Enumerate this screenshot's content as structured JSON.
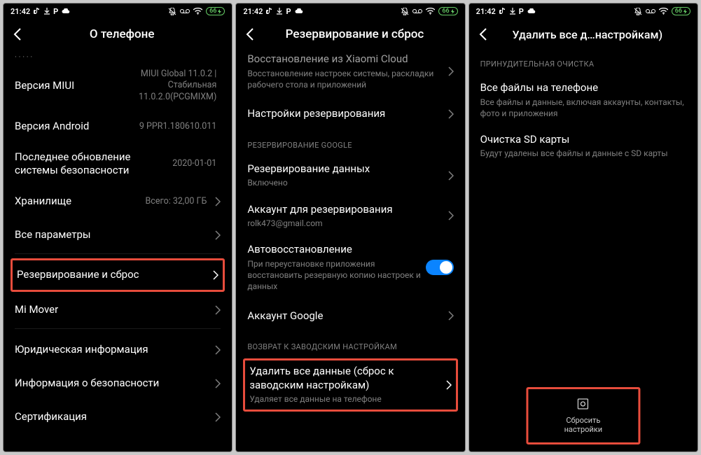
{
  "status": {
    "time": "21:42",
    "battery": "66"
  },
  "screen1": {
    "title": "О телефоне",
    "miui": {
      "label": "Версия MIUI",
      "value": "MIUI Global 11.0.2 | Стабильная 11.0.2.0(PCGMIXM)"
    },
    "android": {
      "label": "Версия Android",
      "value": "9 PPR1.180610.011"
    },
    "security": {
      "label": "Последнее обновление системы безопасности",
      "value": "2020-01-01"
    },
    "storage": {
      "label": "Хранилище",
      "value": "Всего: 32,00 ГБ"
    },
    "allSpecs": {
      "label": "Все параметры"
    },
    "backup": {
      "label": "Резервирование и сброс"
    },
    "miMover": {
      "label": "Mi Mover"
    },
    "legal": {
      "label": "Юридическая информация"
    },
    "safety": {
      "label": "Информация о безопасности"
    },
    "cert": {
      "label": "Сертификация"
    }
  },
  "screen2": {
    "title": "Резервирование и сброс",
    "xiaomiCloud": {
      "label": "Восстановление из Xiaomi Cloud",
      "sub": "Восстановление настроек системы, раскладки рабочего стола и приложений"
    },
    "backupSettings": {
      "label": "Настройки резервирования"
    },
    "sectionGoogle": "РЕЗЕРВИРОВАНИЕ GOOGLE",
    "dataBackup": {
      "label": "Резервирование данных",
      "sub": "Включено"
    },
    "account": {
      "label": "Аккаунт для резервирования",
      "sub": "rolk473@gmail.com"
    },
    "autoRestore": {
      "label": "Автовосстановление",
      "sub": "При переустановке приложения восстановить резервную копию настроек и данных"
    },
    "googleAcct": {
      "label": "Аккаунт Google"
    },
    "sectionFactory": "ВОЗВРАТ К ЗАВОДСКИМ НАСТРОЙКАМ",
    "factoryReset": {
      "label": "Удалить все данные (сброс к заводским настройкам)",
      "sub": "Удаляет все данные на телефоне"
    }
  },
  "screen3": {
    "title": "Удалить все д…настройкам)",
    "sectionForce": "ПРИНУДИТЕЛЬНАЯ ОЧИСТКА",
    "allFiles": {
      "label": "Все файлы на телефоне",
      "sub": "Все файлы и данные, включая аккаунты, контакты, фото и приложения"
    },
    "sdCard": {
      "label": "Очистка SD карты",
      "sub": "Будут удалены все файлы и данные с SD карты"
    },
    "resetBtn": {
      "label": "Сбросить настройки"
    }
  }
}
